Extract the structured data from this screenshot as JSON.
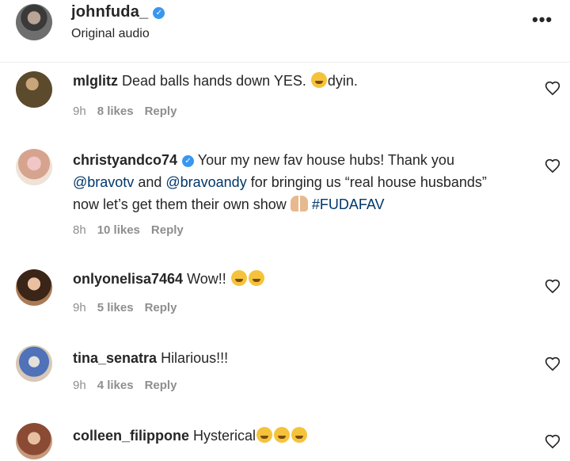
{
  "post": {
    "username": "johnfuda_",
    "subtitle": "Original audio",
    "more_icon": "more-horizontal-icon"
  },
  "comments": [
    {
      "username": "mlglitz",
      "text": "Dead balls hands down YES. ",
      "after_emoji": "dyin.",
      "time": "9h",
      "likes": "8 likes",
      "reply": "Reply"
    },
    {
      "username": "christyandco74",
      "text_1": " Your my new fav house hubs! Thank you ",
      "mention_1": "@bravotv",
      "text_2": " and ",
      "mention_2": "@bravoandy",
      "text_3": " for bringing us “real house husbands” now let’s get them their own show ",
      "hashtag": "#FUDAFAV",
      "time": "8h",
      "likes": "10 likes",
      "reply": "Reply"
    },
    {
      "username": "onlyonelisa7464",
      "text": " Wow!! ",
      "time": "9h",
      "likes": "5 likes",
      "reply": "Reply"
    },
    {
      "username": "tina_senatra",
      "text": " Hilarious!!!",
      "time": "9h",
      "likes": "4 likes",
      "reply": "Reply"
    },
    {
      "username": "colleen_filippone",
      "text": " Hysterical"
    }
  ]
}
